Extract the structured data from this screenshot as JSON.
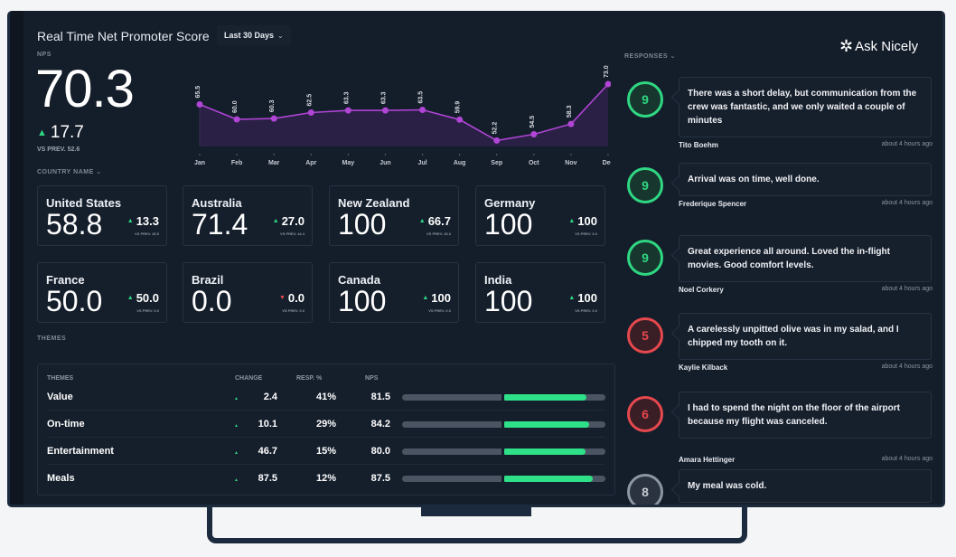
{
  "header": {
    "title": "Real Time Net Promoter Score",
    "period": "Last 30 Days",
    "period_icon": "chevron-down-icon",
    "brand": "Ask Nicely"
  },
  "nps": {
    "label": "NPS",
    "value": "70.3",
    "delta": "17.7",
    "delta_direction": "up",
    "vs_prev": "VS PREV. 52.6"
  },
  "chart_data": {
    "type": "area",
    "categories": [
      "Jan",
      "Feb",
      "Mar",
      "Apr",
      "May",
      "Jun",
      "Jul",
      "Aug",
      "Sep",
      "Oct",
      "Nov",
      "Dec"
    ],
    "values": [
      65.5,
      60.0,
      60.3,
      62.5,
      63.3,
      63.3,
      63.5,
      59.9,
      52.2,
      54.5,
      58.3,
      73.0
    ],
    "labels": [
      "65.5",
      "60.0",
      "60.3",
      "62.5",
      "63.3",
      "63.3",
      "63.5",
      "59.9",
      "52.2",
      "54.5",
      "58.3",
      "73.0"
    ],
    "title": "",
    "xlabel": "",
    "ylabel": "",
    "ylim": [
      50,
      75
    ],
    "grid": false,
    "color": "#b045d6"
  },
  "country_section": {
    "label": "COUNTRY NAME",
    "cards": [
      {
        "name": "United States",
        "value": "58.8",
        "delta": "13.3",
        "dir": "up",
        "prev": "VS PREV. 45.5"
      },
      {
        "name": "Australia",
        "value": "71.4",
        "delta": "27.0",
        "dir": "up",
        "prev": "VS PREV. 44.4"
      },
      {
        "name": "New Zealand",
        "value": "100",
        "delta": "66.7",
        "dir": "up",
        "prev": "VS PREV. 33.3"
      },
      {
        "name": "Germany",
        "value": "100",
        "delta": "100",
        "dir": "up",
        "prev": "VS PREV. 0.0"
      },
      {
        "name": "France",
        "value": "50.0",
        "delta": "50.0",
        "dir": "up",
        "prev": "VS PREV. 0.0"
      },
      {
        "name": "Brazil",
        "value": "0.0",
        "delta": "0.0",
        "dir": "down",
        "prev": "VS PREV. 0.0"
      },
      {
        "name": "Canada",
        "value": "100",
        "delta": "100",
        "dir": "up",
        "prev": "VS PREV. 0.0"
      },
      {
        "name": "India",
        "value": "100",
        "delta": "100",
        "dir": "up",
        "prev": "VS PREV. 0.0"
      }
    ]
  },
  "themes": {
    "section_label": "THEMES",
    "headers": {
      "name": "THEMES",
      "change": "CHANGE",
      "resp": "RESP. %",
      "nps": "NPS"
    },
    "rows": [
      {
        "name": "Value",
        "change": "2.4",
        "resp": "41%",
        "nps": "81.5",
        "nps_fraction": 0.815
      },
      {
        "name": "On-time",
        "change": "10.1",
        "resp": "29%",
        "nps": "84.2",
        "nps_fraction": 0.842
      },
      {
        "name": "Entertainment",
        "change": "46.7",
        "resp": "15%",
        "nps": "80.0",
        "nps_fraction": 0.8
      },
      {
        "name": "Meals",
        "change": "87.5",
        "resp": "12%",
        "nps": "87.5",
        "nps_fraction": 0.875
      }
    ]
  },
  "responses": {
    "label": "RESPONSES",
    "items": [
      {
        "score": "9",
        "type": "promoter",
        "text": "There was a short delay, but communication from the crew was fantastic, and we only waited a couple of minutes",
        "name": "Tito Boehm",
        "time": "about 4 hours ago"
      },
      {
        "score": "9",
        "type": "promoter",
        "text": "Arrival was on time, well done.",
        "name": "Frederique Spencer",
        "time": "about 4 hours ago"
      },
      {
        "score": "9",
        "type": "promoter",
        "text": "Great experience all around. Loved the in-flight movies. Good comfort levels.",
        "name": "Noel Corkery",
        "time": "about 4 hours ago"
      },
      {
        "score": "5",
        "type": "detractor",
        "text": "A carelessly unpitted olive was in my salad, and I chipped my tooth on it.",
        "name": "Kaylie Kilback",
        "time": "about 4 hours ago"
      },
      {
        "score": "6",
        "type": "detractor",
        "text": "I had to spend the night on the floor of the airport because my flight was canceled.",
        "name": "Amara Hettinger",
        "time": "about 4 hours ago"
      },
      {
        "score": "8",
        "type": "passive",
        "text": "My meal was cold.",
        "name": "",
        "time": ""
      }
    ]
  }
}
